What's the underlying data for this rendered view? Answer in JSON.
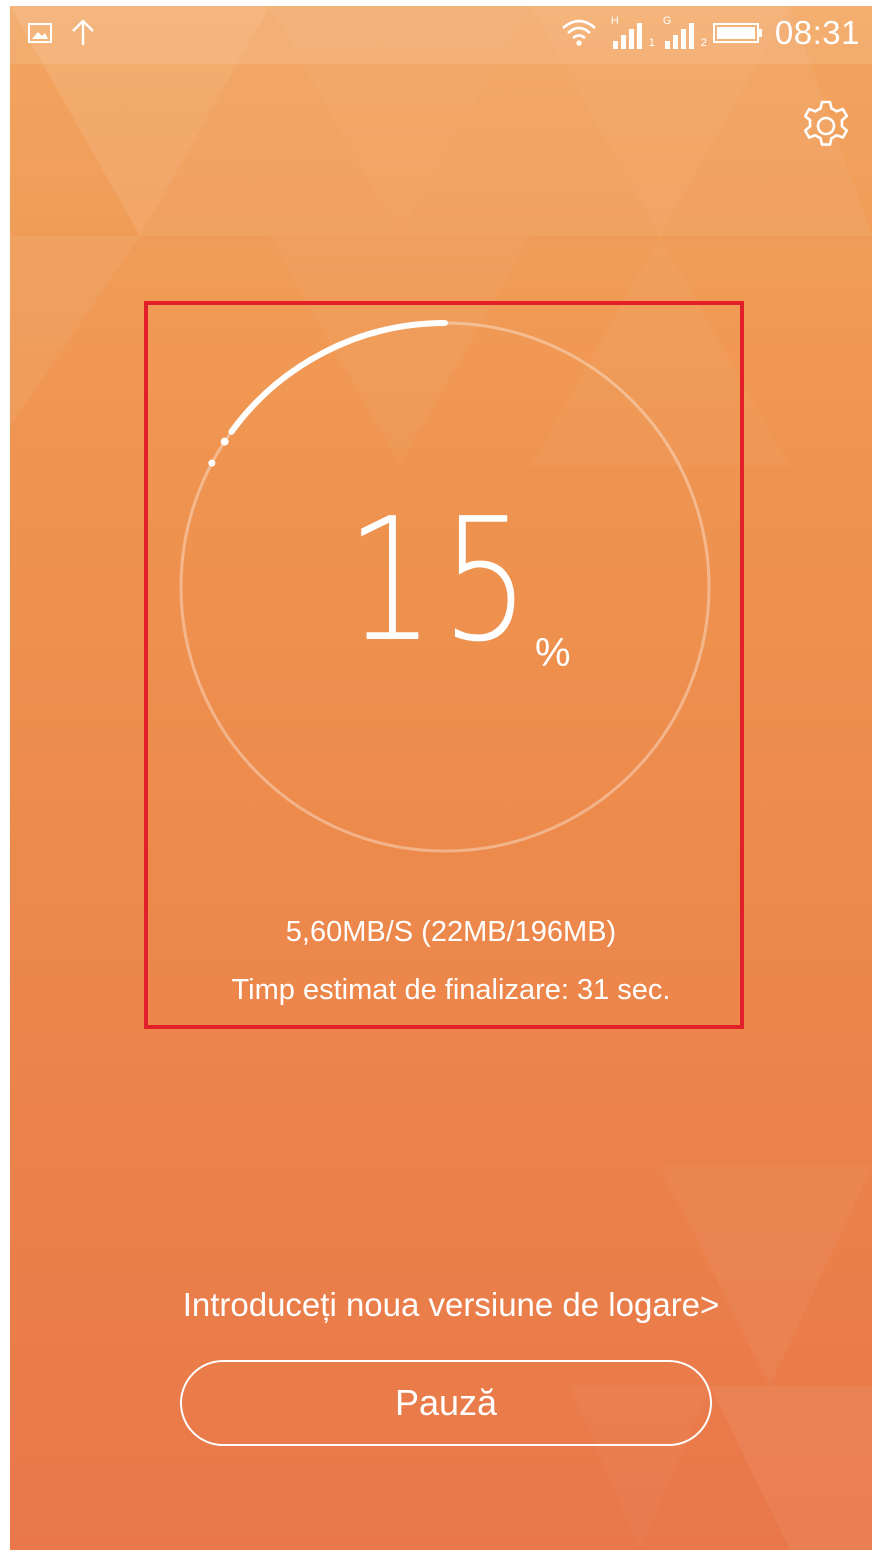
{
  "status_bar": {
    "time": "08:31",
    "left_icons": [
      "image-icon",
      "upload-arrow-icon"
    ],
    "right_icons": [
      "wifi-icon",
      "signal-sim1-icon",
      "signal-sim2-icon",
      "battery-icon"
    ],
    "sim1_network": "H",
    "sim1_index": "1",
    "sim2_network": "G",
    "sim2_index": "2"
  },
  "header": {
    "settings_icon": "gear-icon"
  },
  "progress": {
    "percent_value": "15",
    "percent_sign": "%",
    "fraction": 0.15
  },
  "transfer": {
    "speed_line": "5,60MB/S (22MB/196MB)",
    "eta_line": "Timp estimat de finalizare: 31 sec."
  },
  "actions": {
    "login_link": "Introduceți noua versiune de logare>",
    "pause_label": "Pauză"
  },
  "colors": {
    "background_top": "#f2a560",
    "background_bottom": "#e9774a",
    "highlight_border": "#e3202a"
  }
}
